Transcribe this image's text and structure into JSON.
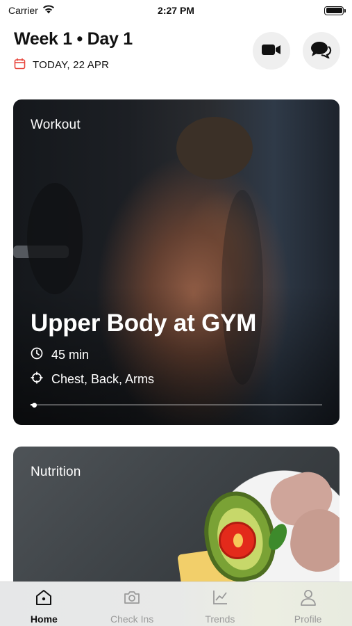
{
  "status_bar": {
    "carrier": "Carrier",
    "time": "2:27 PM"
  },
  "header": {
    "title": "Week 1 • Day 1",
    "date": "TODAY, 22 APR",
    "video_icon": "video-camera-icon",
    "chat_icon": "chat-bubbles-icon",
    "accent_color": "#e8453c"
  },
  "workout_card": {
    "label": "Workout",
    "title": "Upper Body at GYM",
    "duration": "45 min",
    "targets": "Chest, Back, Arms",
    "progress": 0.01
  },
  "nutrition_card": {
    "label": "Nutrition"
  },
  "tabs": [
    {
      "label": "Home",
      "icon": "home-icon",
      "active": true
    },
    {
      "label": "Check Ins",
      "icon": "camera-icon",
      "active": false
    },
    {
      "label": "Trends",
      "icon": "chart-icon",
      "active": false
    },
    {
      "label": "Profile",
      "icon": "person-icon",
      "active": false
    }
  ]
}
